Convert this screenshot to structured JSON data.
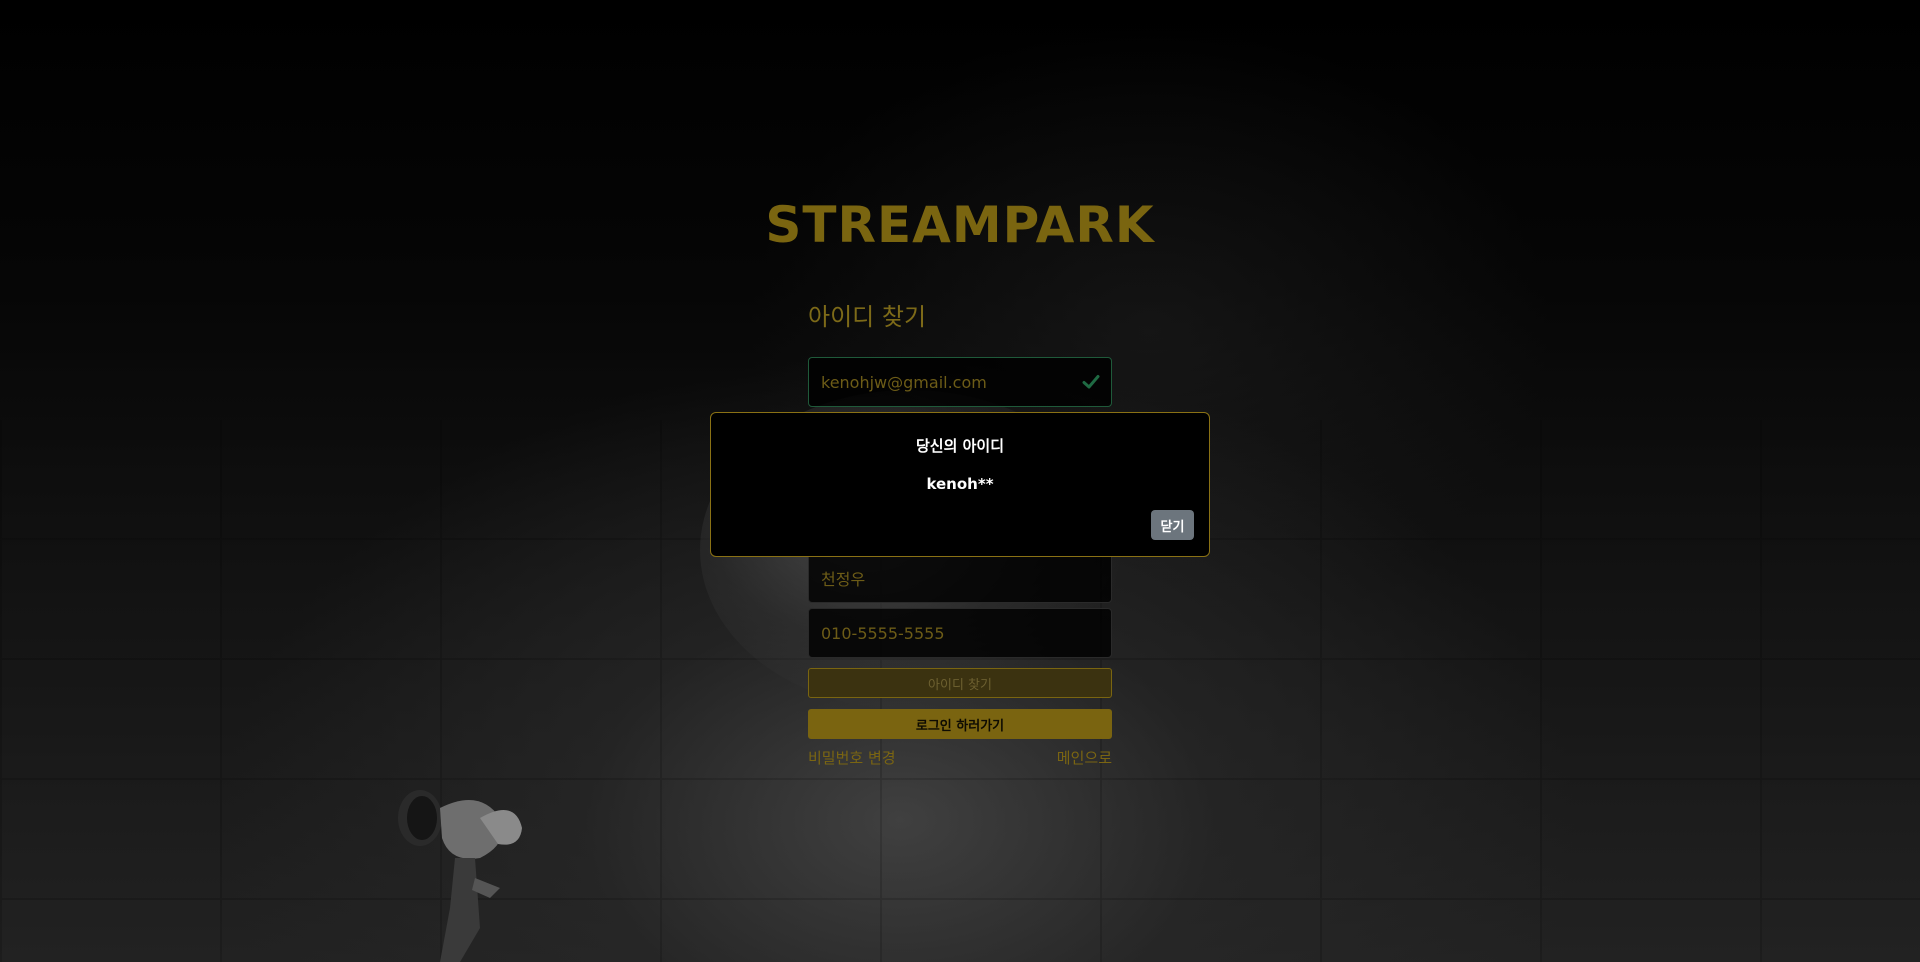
{
  "brand": {
    "logo_text": "STREAMPARK"
  },
  "form": {
    "title": "아이디 찾기",
    "email_value": "kenohjw@gmail.com",
    "name_value": "천정우",
    "phone_value": "010-5555-5555",
    "find_button_label": "아이디 찾기",
    "login_button_label": "로그인 하러가기",
    "change_password_link": "비밀번호 변경",
    "main_link": "메인으로"
  },
  "modal": {
    "title": "당신의 아이디",
    "found_id": "kenoh**",
    "close_label": "닫기"
  },
  "colors": {
    "accent": "#7a6510",
    "valid_check": "#1f6a43",
    "close_button": "#6c757d"
  },
  "icons": {
    "email_status": "check-icon"
  }
}
